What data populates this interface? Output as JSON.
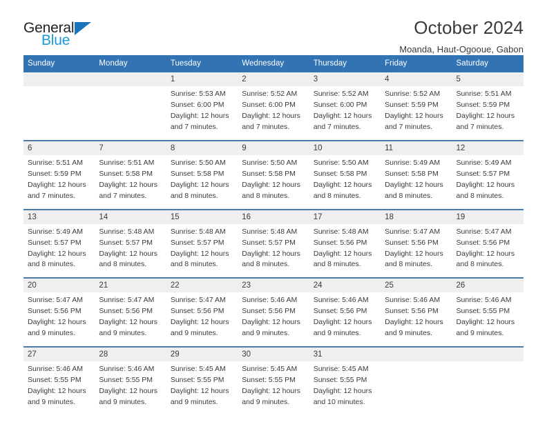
{
  "brand": {
    "line1": "General",
    "line2": "Blue",
    "triangle_icon": "blue-triangle-logo-mark",
    "colors": {
      "general_text": "#231f20",
      "blue_text": "#1b9ad6",
      "triangle": "#1b75bb"
    }
  },
  "header": {
    "title": "October 2024",
    "subtitle": "Moanda, Haut-Ogooue, Gabon"
  },
  "colors": {
    "header_row_bg": "#3273b4",
    "header_row_text": "#ffffff",
    "day_number_strip_bg": "#efefef",
    "row_separator": "#4a7ba7",
    "body_text": "#3a3a3a"
  },
  "calendar": {
    "weekday_headers": [
      "Sunday",
      "Monday",
      "Tuesday",
      "Wednesday",
      "Thursday",
      "Friday",
      "Saturday"
    ],
    "weeks": [
      {
        "numbers": [
          "",
          "",
          "1",
          "2",
          "3",
          "4",
          "5"
        ],
        "details": [
          {
            "sunrise": "",
            "sunset": "",
            "daylight_line1": "",
            "daylight_line2": ""
          },
          {
            "sunrise": "",
            "sunset": "",
            "daylight_line1": "",
            "daylight_line2": ""
          },
          {
            "sunrise": "Sunrise: 5:53 AM",
            "sunset": "Sunset: 6:00 PM",
            "daylight_line1": "Daylight: 12 hours",
            "daylight_line2": "and 7 minutes."
          },
          {
            "sunrise": "Sunrise: 5:52 AM",
            "sunset": "Sunset: 6:00 PM",
            "daylight_line1": "Daylight: 12 hours",
            "daylight_line2": "and 7 minutes."
          },
          {
            "sunrise": "Sunrise: 5:52 AM",
            "sunset": "Sunset: 6:00 PM",
            "daylight_line1": "Daylight: 12 hours",
            "daylight_line2": "and 7 minutes."
          },
          {
            "sunrise": "Sunrise: 5:52 AM",
            "sunset": "Sunset: 5:59 PM",
            "daylight_line1": "Daylight: 12 hours",
            "daylight_line2": "and 7 minutes."
          },
          {
            "sunrise": "Sunrise: 5:51 AM",
            "sunset": "Sunset: 5:59 PM",
            "daylight_line1": "Daylight: 12 hours",
            "daylight_line2": "and 7 minutes."
          }
        ]
      },
      {
        "numbers": [
          "6",
          "7",
          "8",
          "9",
          "10",
          "11",
          "12"
        ],
        "details": [
          {
            "sunrise": "Sunrise: 5:51 AM",
            "sunset": "Sunset: 5:59 PM",
            "daylight_line1": "Daylight: 12 hours",
            "daylight_line2": "and 7 minutes."
          },
          {
            "sunrise": "Sunrise: 5:51 AM",
            "sunset": "Sunset: 5:58 PM",
            "daylight_line1": "Daylight: 12 hours",
            "daylight_line2": "and 7 minutes."
          },
          {
            "sunrise": "Sunrise: 5:50 AM",
            "sunset": "Sunset: 5:58 PM",
            "daylight_line1": "Daylight: 12 hours",
            "daylight_line2": "and 8 minutes."
          },
          {
            "sunrise": "Sunrise: 5:50 AM",
            "sunset": "Sunset: 5:58 PM",
            "daylight_line1": "Daylight: 12 hours",
            "daylight_line2": "and 8 minutes."
          },
          {
            "sunrise": "Sunrise: 5:50 AM",
            "sunset": "Sunset: 5:58 PM",
            "daylight_line1": "Daylight: 12 hours",
            "daylight_line2": "and 8 minutes."
          },
          {
            "sunrise": "Sunrise: 5:49 AM",
            "sunset": "Sunset: 5:58 PM",
            "daylight_line1": "Daylight: 12 hours",
            "daylight_line2": "and 8 minutes."
          },
          {
            "sunrise": "Sunrise: 5:49 AM",
            "sunset": "Sunset: 5:57 PM",
            "daylight_line1": "Daylight: 12 hours",
            "daylight_line2": "and 8 minutes."
          }
        ]
      },
      {
        "numbers": [
          "13",
          "14",
          "15",
          "16",
          "17",
          "18",
          "19"
        ],
        "details": [
          {
            "sunrise": "Sunrise: 5:49 AM",
            "sunset": "Sunset: 5:57 PM",
            "daylight_line1": "Daylight: 12 hours",
            "daylight_line2": "and 8 minutes."
          },
          {
            "sunrise": "Sunrise: 5:48 AM",
            "sunset": "Sunset: 5:57 PM",
            "daylight_line1": "Daylight: 12 hours",
            "daylight_line2": "and 8 minutes."
          },
          {
            "sunrise": "Sunrise: 5:48 AM",
            "sunset": "Sunset: 5:57 PM",
            "daylight_line1": "Daylight: 12 hours",
            "daylight_line2": "and 8 minutes."
          },
          {
            "sunrise": "Sunrise: 5:48 AM",
            "sunset": "Sunset: 5:57 PM",
            "daylight_line1": "Daylight: 12 hours",
            "daylight_line2": "and 8 minutes."
          },
          {
            "sunrise": "Sunrise: 5:48 AM",
            "sunset": "Sunset: 5:56 PM",
            "daylight_line1": "Daylight: 12 hours",
            "daylight_line2": "and 8 minutes."
          },
          {
            "sunrise": "Sunrise: 5:47 AM",
            "sunset": "Sunset: 5:56 PM",
            "daylight_line1": "Daylight: 12 hours",
            "daylight_line2": "and 8 minutes."
          },
          {
            "sunrise": "Sunrise: 5:47 AM",
            "sunset": "Sunset: 5:56 PM",
            "daylight_line1": "Daylight: 12 hours",
            "daylight_line2": "and 8 minutes."
          }
        ]
      },
      {
        "numbers": [
          "20",
          "21",
          "22",
          "23",
          "24",
          "25",
          "26"
        ],
        "details": [
          {
            "sunrise": "Sunrise: 5:47 AM",
            "sunset": "Sunset: 5:56 PM",
            "daylight_line1": "Daylight: 12 hours",
            "daylight_line2": "and 9 minutes."
          },
          {
            "sunrise": "Sunrise: 5:47 AM",
            "sunset": "Sunset: 5:56 PM",
            "daylight_line1": "Daylight: 12 hours",
            "daylight_line2": "and 9 minutes."
          },
          {
            "sunrise": "Sunrise: 5:47 AM",
            "sunset": "Sunset: 5:56 PM",
            "daylight_line1": "Daylight: 12 hours",
            "daylight_line2": "and 9 minutes."
          },
          {
            "sunrise": "Sunrise: 5:46 AM",
            "sunset": "Sunset: 5:56 PM",
            "daylight_line1": "Daylight: 12 hours",
            "daylight_line2": "and 9 minutes."
          },
          {
            "sunrise": "Sunrise: 5:46 AM",
            "sunset": "Sunset: 5:56 PM",
            "daylight_line1": "Daylight: 12 hours",
            "daylight_line2": "and 9 minutes."
          },
          {
            "sunrise": "Sunrise: 5:46 AM",
            "sunset": "Sunset: 5:56 PM",
            "daylight_line1": "Daylight: 12 hours",
            "daylight_line2": "and 9 minutes."
          },
          {
            "sunrise": "Sunrise: 5:46 AM",
            "sunset": "Sunset: 5:55 PM",
            "daylight_line1": "Daylight: 12 hours",
            "daylight_line2": "and 9 minutes."
          }
        ]
      },
      {
        "numbers": [
          "27",
          "28",
          "29",
          "30",
          "31",
          "",
          ""
        ],
        "details": [
          {
            "sunrise": "Sunrise: 5:46 AM",
            "sunset": "Sunset: 5:55 PM",
            "daylight_line1": "Daylight: 12 hours",
            "daylight_line2": "and 9 minutes."
          },
          {
            "sunrise": "Sunrise: 5:46 AM",
            "sunset": "Sunset: 5:55 PM",
            "daylight_line1": "Daylight: 12 hours",
            "daylight_line2": "and 9 minutes."
          },
          {
            "sunrise": "Sunrise: 5:45 AM",
            "sunset": "Sunset: 5:55 PM",
            "daylight_line1": "Daylight: 12 hours",
            "daylight_line2": "and 9 minutes."
          },
          {
            "sunrise": "Sunrise: 5:45 AM",
            "sunset": "Sunset: 5:55 PM",
            "daylight_line1": "Daylight: 12 hours",
            "daylight_line2": "and 9 minutes."
          },
          {
            "sunrise": "Sunrise: 5:45 AM",
            "sunset": "Sunset: 5:55 PM",
            "daylight_line1": "Daylight: 12 hours",
            "daylight_line2": "and 10 minutes."
          },
          {
            "sunrise": "",
            "sunset": "",
            "daylight_line1": "",
            "daylight_line2": ""
          },
          {
            "sunrise": "",
            "sunset": "",
            "daylight_line1": "",
            "daylight_line2": ""
          }
        ]
      }
    ]
  }
}
